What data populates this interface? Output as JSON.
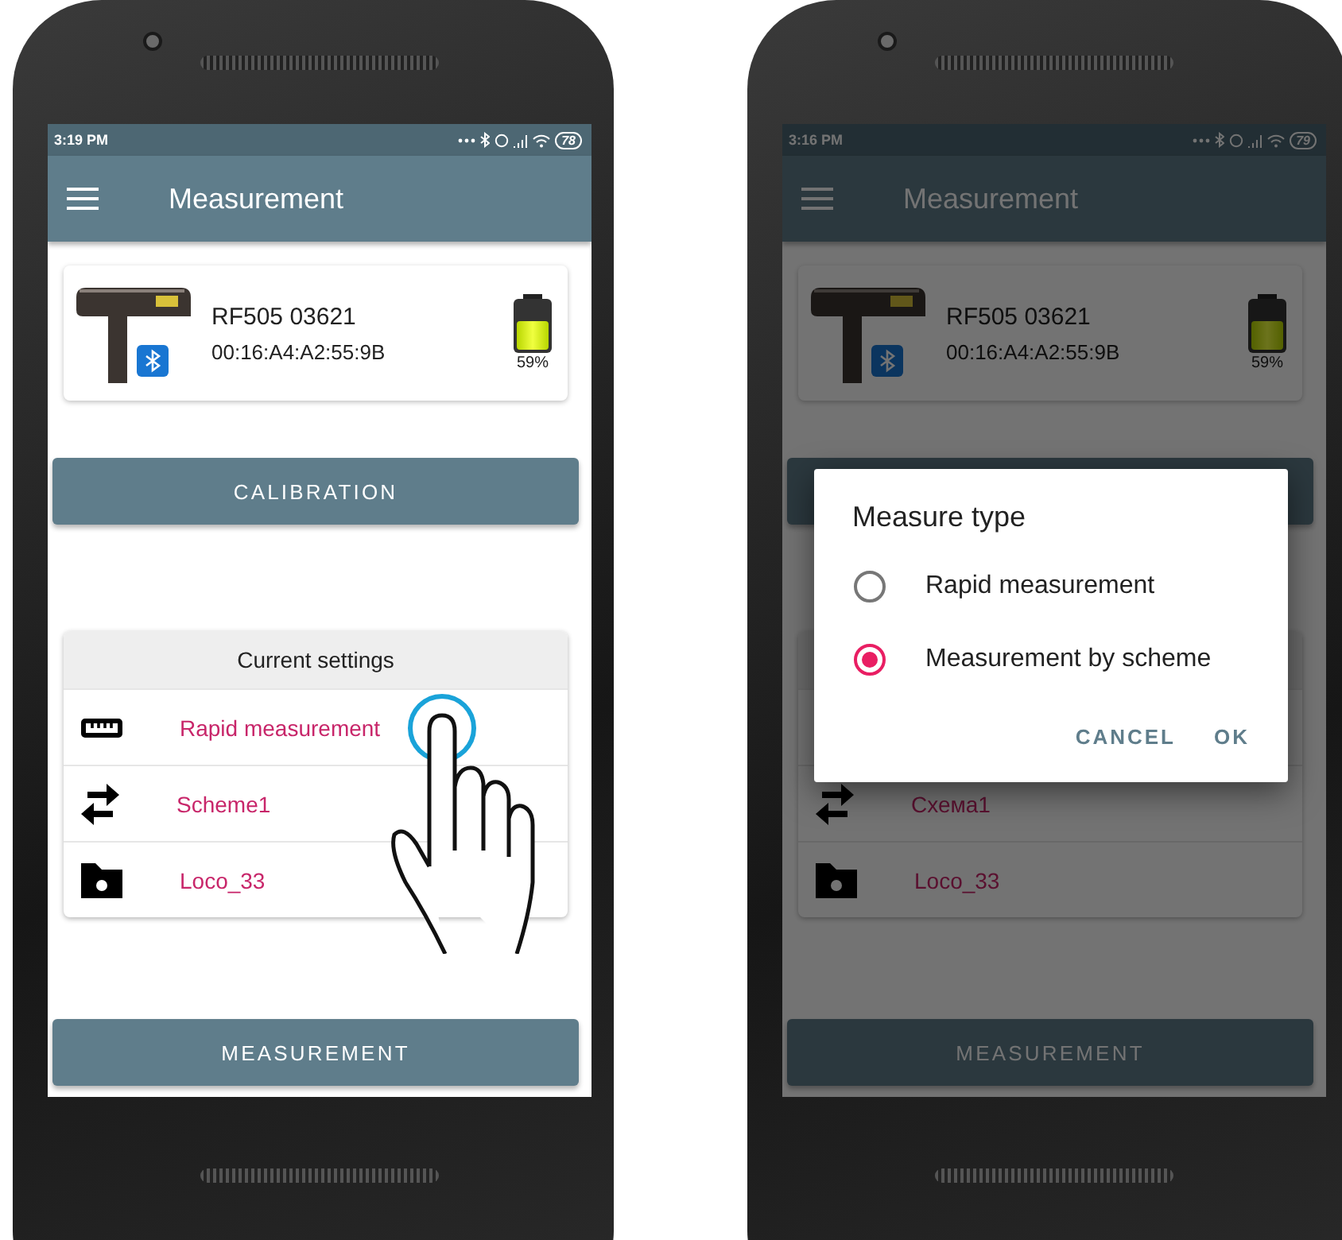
{
  "screens": [
    {
      "status_bar": {
        "time": "3:19 PM",
        "battery": "78"
      },
      "app_bar": {
        "title": "Measurement"
      },
      "device": {
        "name": "RF505 03621",
        "address": "00:16:A4:A2:55:9B",
        "battery_reading": "59%",
        "level": 0.59
      },
      "calibration_button": {
        "label": "CALIBRATION"
      },
      "settings": {
        "header": "Current settings",
        "rows": [
          {
            "kind": "ruler",
            "label": "Rapid measurement"
          },
          {
            "kind": "swap",
            "label": "Scheme1"
          },
          {
            "kind": "folder",
            "label": "Loco_33"
          }
        ]
      },
      "measurement_button": {
        "label": "MEASUREMENT"
      },
      "tap_hint": true,
      "dimmed": false
    },
    {
      "status_bar": {
        "time": "3:16 PM",
        "battery": "79"
      },
      "app_bar": {
        "title": "Measurement"
      },
      "device": {
        "name": "RF505 03621",
        "address": "00:16:A4:A2:55:9B",
        "battery_reading": "59%",
        "level": 0.59
      },
      "settings": {
        "rows": [
          {
            "kind": "hidden"
          },
          {
            "kind": "swap",
            "label": "Схема1"
          },
          {
            "kind": "folder",
            "label": "Loco_33"
          }
        ]
      },
      "measurement_button": {
        "label": "MEASUREMENT"
      },
      "tap_hint": false,
      "dimmed": true,
      "dialog": {
        "title": "Measure type",
        "options": [
          {
            "label": "Rapid measurement",
            "selected": false
          },
          {
            "label": "Measurement by scheme",
            "selected": true
          }
        ],
        "buttons": [
          "CANCEL",
          "OK"
        ]
      }
    }
  ]
}
